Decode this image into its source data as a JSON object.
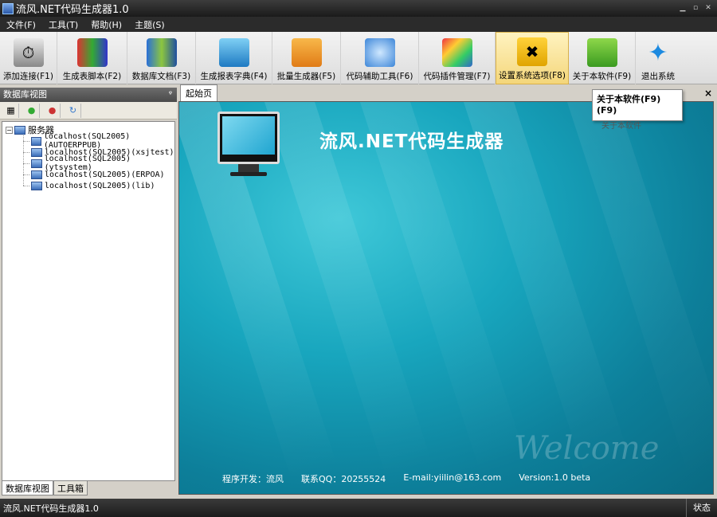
{
  "window": {
    "title": "流风.NET代码生成器1.0"
  },
  "menu": [
    "文件(F)",
    "工具(T)",
    "帮助(H)",
    "主题(S)"
  ],
  "toolbar": [
    {
      "label": "添加连接(F1)",
      "icon": "connect-icon"
    },
    {
      "label": "生成表脚本(F2)",
      "icon": "binders-icon"
    },
    {
      "label": "数据库文档(F3)",
      "icon": "books-icon"
    },
    {
      "label": "生成报表字典(F4)",
      "icon": "stack-icon"
    },
    {
      "label": "批量生成器(F5)",
      "icon": "batch-icon"
    },
    {
      "label": "代码辅助工具(F6)",
      "icon": "globe-check-icon"
    },
    {
      "label": "代码插件管理(F7)",
      "icon": "palette-icon"
    },
    {
      "label": "设置系统选项(F8)",
      "icon": "tools-icon"
    },
    {
      "label": "关于本软件(F9)",
      "icon": "about-icon"
    },
    {
      "label": "退出系统",
      "icon": "exit-icon"
    }
  ],
  "left_panel": {
    "title": "数据库视图",
    "tree_root": "服务器",
    "servers": [
      "localhost(SQL2005)(AUTOERPPUB)",
      "localhost(SQL2005)(xsjtest)",
      "localhost(SQL2005)(ytsystem)",
      "localhost(SQL2005)(ERPOA)",
      "localhost(SQL2005)(lib)"
    ],
    "tabs": [
      "数据库视图",
      "工具箱"
    ]
  },
  "doc": {
    "tab": "起始页",
    "heading": "流风.NET代码生成器",
    "footer": {
      "dev": "程序开发：流风",
      "qq": "联系QQ：20255524",
      "email": "E-mail:yiilin@163.com",
      "version": "Version:1.0 beta"
    },
    "script": "Welcome"
  },
  "tooltip": {
    "title": "关于本软件(F9) (F9)",
    "body": "关于本软件"
  },
  "status": {
    "left": "流风.NET代码生成器1.0",
    "right": "状态"
  }
}
